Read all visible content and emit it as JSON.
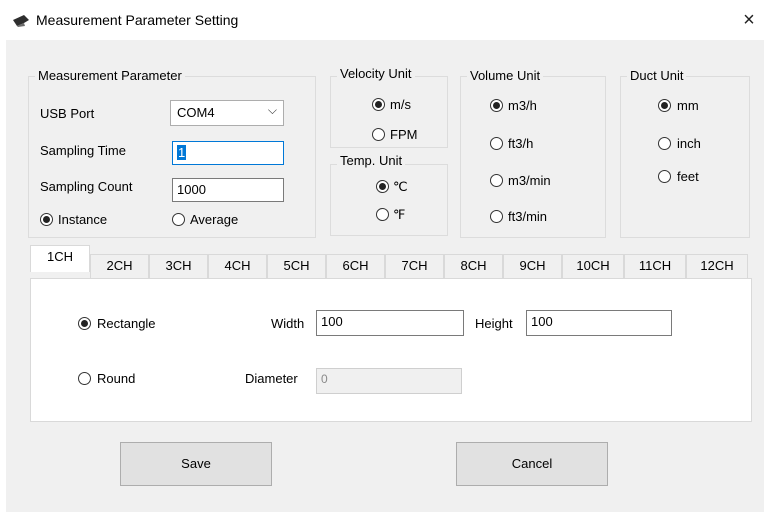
{
  "window": {
    "title": "Measurement Parameter Setting",
    "close_glyph": "×"
  },
  "measurement": {
    "legend": "Measurement Parameter",
    "usb_port_label": "USB Port",
    "usb_port_value": "COM4",
    "sampling_time_label": "Sampling Time",
    "sampling_time_value": "1",
    "sampling_count_label": "Sampling Count",
    "sampling_count_value": "1000",
    "mode_options": [
      "Instance",
      "Average"
    ],
    "mode_selected": "Instance"
  },
  "velocity_unit": {
    "legend": "Velocity Unit",
    "options": [
      "m/s",
      "FPM"
    ],
    "selected": "m/s"
  },
  "temp_unit": {
    "legend": "Temp. Unit",
    "options": [
      "℃",
      "℉"
    ],
    "selected": "℃"
  },
  "volume_unit": {
    "legend": "Volume Unit",
    "options": [
      "m3/h",
      "ft3/h",
      "m3/min",
      "ft3/min"
    ],
    "selected": "m3/h"
  },
  "duct_unit": {
    "legend": "Duct Unit",
    "options": [
      "mm",
      "inch",
      "feet"
    ],
    "selected": "mm"
  },
  "tabs": [
    "1CH",
    "2CH",
    "3CH",
    "4CH",
    "5CH",
    "6CH",
    "7CH",
    "8CH",
    "9CH",
    "10CH",
    "11CH",
    "12CH"
  ],
  "active_tab": "1CH",
  "channel": {
    "shape_options": [
      "Rectangle",
      "Round"
    ],
    "shape_selected": "Rectangle",
    "width_label": "Width",
    "width_value": "100",
    "height_label": "Height",
    "height_value": "100",
    "diameter_label": "Diameter",
    "diameter_value": "0"
  },
  "buttons": {
    "save": "Save",
    "cancel": "Cancel"
  }
}
